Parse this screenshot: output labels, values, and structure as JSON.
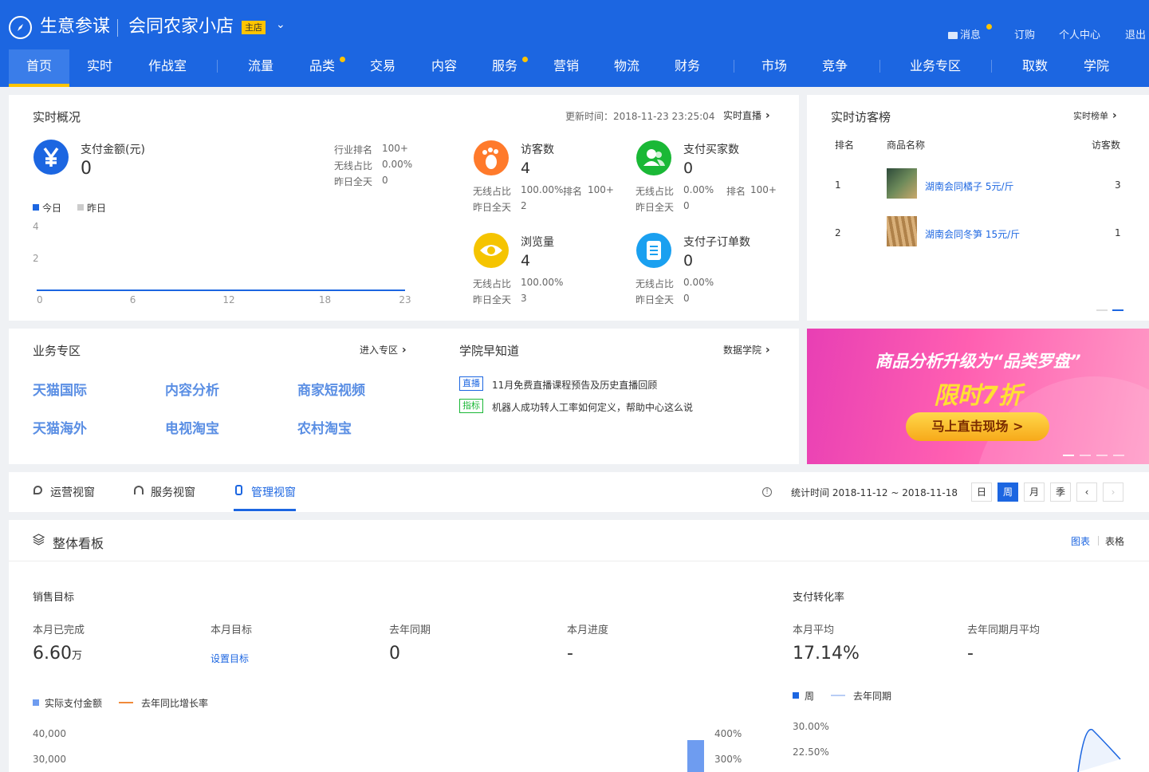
{
  "header": {
    "brand": "生意参谋",
    "shop_name": "会同农家小店",
    "shop_badge": "主店",
    "top_links": {
      "messages": "消息",
      "subscribe": "订购",
      "profile": "个人中心",
      "logout": "退出"
    },
    "nav": [
      "首页",
      "实时",
      "作战室",
      "流量",
      "品类",
      "交易",
      "内容",
      "服务",
      "营销",
      "物流",
      "财务",
      "市场",
      "竞争",
      "业务专区",
      "取数",
      "学院"
    ],
    "active_nav": "首页",
    "accent": "#1c66e1",
    "notice_color": "#ffc400"
  },
  "realtime": {
    "title": "实时概况",
    "update_time": "更新时间：2018-11-23 23:25:04",
    "live_link": "实时直播",
    "pay_amount": {
      "label": "支付金额(元)",
      "value": "0",
      "rank_label": "行业排名",
      "rank": "100+",
      "wireless_label": "无线占比",
      "wireless": "0.00%",
      "yesterday_label": "昨日全天",
      "yesterday": "0"
    },
    "legend": {
      "today": "今日",
      "yesterday": "昨日"
    },
    "chart_data": {
      "type": "line",
      "series": [
        {
          "name": "今日",
          "values": [
            0,
            0,
            0,
            0,
            0,
            0,
            0,
            0,
            0,
            0,
            0,
            0,
            0,
            0,
            0,
            0,
            0,
            0,
            0,
            0,
            0,
            0,
            0,
            0
          ]
        }
      ],
      "x": [
        0,
        1,
        2,
        3,
        4,
        5,
        6,
        7,
        8,
        9,
        10,
        11,
        12,
        13,
        14,
        15,
        16,
        17,
        18,
        19,
        20,
        21,
        22,
        23
      ],
      "xticks": [
        "0",
        "6",
        "12",
        "18",
        "23"
      ],
      "yticks": [
        "4",
        "2"
      ],
      "ylim": [
        0,
        4
      ]
    },
    "metrics": [
      {
        "label": "访客数",
        "value": "4",
        "l1": "无线占比",
        "v1": "100.00%",
        "rank_label": "排名",
        "rank": "100+",
        "l2": "昨日全天",
        "v2": "2",
        "icon": "footprint-icon",
        "color": "#ff7a2b"
      },
      {
        "label": "支付买家数",
        "value": "0",
        "l1": "无线占比",
        "v1": "0.00%",
        "rank_label": "排名",
        "rank": "100+",
        "l2": "昨日全天",
        "v2": "0",
        "icon": "users-icon",
        "color": "#1ab836"
      },
      {
        "label": "浏览量",
        "value": "4",
        "l1": "无线占比",
        "v1": "100.00%",
        "l2": "昨日全天",
        "v2": "3",
        "icon": "eye-icon",
        "color": "#f5c400"
      },
      {
        "label": "支付子订单数",
        "value": "0",
        "l1": "无线占比",
        "v1": "0.00%",
        "l2": "昨日全天",
        "v2": "0",
        "icon": "order-icon",
        "color": "#1aa0f0"
      }
    ]
  },
  "ranking": {
    "title": "实时访客榜",
    "link": "实时榜单",
    "headers": [
      "排名",
      "商品名称",
      "访客数"
    ],
    "rows": [
      {
        "rank": "1",
        "name": "湖南会同橘子 5元/斤",
        "visitors": "3"
      },
      {
        "rank": "2",
        "name": "湖南会同冬笋 15元/斤",
        "visitors": "1"
      }
    ]
  },
  "business": {
    "title": "业务专区",
    "link": "进入专区",
    "items": [
      "天猫国际",
      "内容分析",
      "商家短视频",
      "天猫海外",
      "电视淘宝",
      "农村淘宝"
    ]
  },
  "academy": {
    "title": "学院早知道",
    "link": "数据学院",
    "news": [
      {
        "tag": "直播",
        "text": "11月免费直播课程预告及历史直播回顾"
      },
      {
        "tag": "指标",
        "text": "机器人成功转人工率如何定义，帮助中心这么说"
      }
    ]
  },
  "banner": {
    "line1": "商品分析升级为“品类罗盘”",
    "line2": "限时7折",
    "button": "马上直击现场 >"
  },
  "view_tabs": {
    "tabs": [
      "运营视窗",
      "服务视窗",
      "管理视窗"
    ],
    "active": "管理视窗",
    "stat_time": "统计时间 2018-11-12 ~ 2018-11-18",
    "periods": [
      "日",
      "周",
      "月",
      "季"
    ],
    "active_period": "周"
  },
  "board": {
    "title": "整体看板",
    "view_chart": "图表",
    "view_table": "表格",
    "sales": {
      "title": "销售目标",
      "done_label": "本月已完成",
      "done": "6.60",
      "done_unit": "万",
      "target_label": "本月目标",
      "target_link": "设置目标",
      "ly_label": "去年同期",
      "ly": "0",
      "progress_label": "本月进度",
      "progress": "-",
      "legend": [
        "实际支付金额",
        "去年同比增长率"
      ],
      "yticks": [
        "40,000",
        "30,000"
      ],
      "y2ticks": [
        "400%",
        "300%"
      ]
    },
    "conversion": {
      "title": "支付转化率",
      "avg_label": "本月平均",
      "avg": "17.14%",
      "ly_label": "去年同期月平均",
      "ly": "-",
      "legend": [
        "周",
        "去年同期"
      ],
      "yticks": [
        "30.00%",
        "22.50%"
      ]
    }
  }
}
